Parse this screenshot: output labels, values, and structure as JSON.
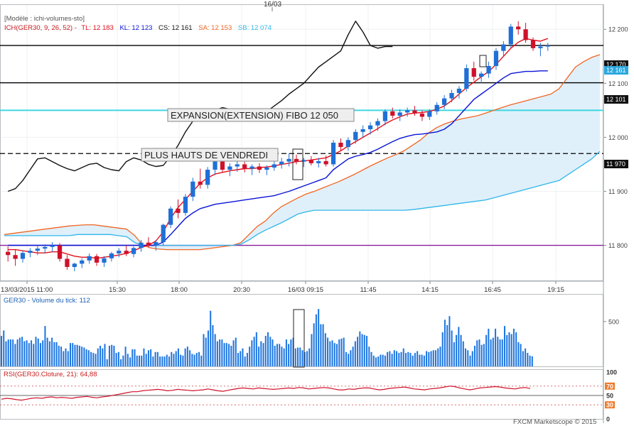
{
  "header": {
    "date_marker": "16/03",
    "model_label": "[Modèle : ichi-volumes-sto]",
    "ichimoku": {
      "name": "ICH(GER30, 9, 26, 52) -",
      "tl_label": "TL: 12 183",
      "kl_label": "KL: 12 123",
      "cs_label": "CS: 12 161",
      "sa_label": "SA: 12 153",
      "sb_label": "SB: 12 074"
    }
  },
  "colors": {
    "candle_up": "#1f6fd6",
    "candle_down": "#d0112b",
    "tenkan": "#e3101a",
    "kijun": "#0a14d6",
    "chikou": "#111111",
    "senkou_a": "#f26522",
    "senkou_b": "#30b6ea",
    "cloud_fill": "#dff0fa",
    "volume": "#1e76e0",
    "rsi": "#d0112b",
    "highlight": "#fff56a"
  },
  "annotations": {
    "fibo": "EXPANSION(EXTENSION) FIBO 12 050",
    "friday_highs": "PLUS HAUTS DE VENDREDI"
  },
  "price_tags": {
    "tag_12170": "12 170",
    "tag_12161": "12 161",
    "tag_12101": "12 101",
    "tag_11970": "11 970"
  },
  "volume_panel": {
    "label": "GER30 - Volume du tick: 112"
  },
  "rsi_panel": {
    "label": "RSI(GER30.Cloture, 21): 64,88"
  },
  "footer": {
    "credit": "FXCM Marketscope © 2015"
  },
  "chart_data": [
    {
      "type": "candlestick",
      "title": "",
      "x_ticks": [
        "13/03/2015 11:00",
        "15:30",
        "18:00",
        "20:30",
        "16/03 09:15",
        "11:45",
        "14:15",
        "16:45",
        "19:15"
      ],
      "y_ticks": [
        11800,
        11900,
        12000,
        12100,
        12200
      ],
      "ylim": [
        11735,
        12245
      ],
      "horizontal_levels": [
        {
          "value": 12170,
          "style": "solid",
          "color": "#000000"
        },
        {
          "value": 12101,
          "style": "solid",
          "color": "#000000"
        },
        {
          "value": 12050,
          "style": "solid",
          "color": "#3fd6e0"
        },
        {
          "value": 11970,
          "style": "dashed",
          "color": "#000000"
        },
        {
          "value": 11800,
          "style": "solid",
          "color": "#8a1f9a"
        }
      ],
      "candles": [
        [
          11788,
          11798,
          11770,
          11782
        ],
        [
          11782,
          11792,
          11762,
          11775
        ],
        [
          11775,
          11790,
          11768,
          11786
        ],
        [
          11786,
          11795,
          11778,
          11790
        ],
        [
          11790,
          11800,
          11782,
          11794
        ],
        [
          11794,
          11802,
          11785,
          11797
        ],
        [
          11797,
          11806,
          11788,
          11800
        ],
        [
          11800,
          11804,
          11770,
          11775
        ],
        [
          11775,
          11782,
          11755,
          11760
        ],
        [
          11760,
          11768,
          11752,
          11766
        ],
        [
          11766,
          11776,
          11758,
          11772
        ],
        [
          11772,
          11785,
          11766,
          11780
        ],
        [
          11780,
          11784,
          11762,
          11768
        ],
        [
          11768,
          11780,
          11760,
          11776
        ],
        [
          11776,
          11788,
          11770,
          11785
        ],
        [
          11785,
          11795,
          11778,
          11790
        ],
        [
          11790,
          11800,
          11780,
          11784
        ],
        [
          11784,
          11798,
          11778,
          11795
        ],
        [
          11795,
          11810,
          11788,
          11805
        ],
        [
          11805,
          11815,
          11796,
          11800
        ],
        [
          11800,
          11810,
          11790,
          11806
        ],
        [
          11806,
          11840,
          11800,
          11838
        ],
        [
          11838,
          11872,
          11832,
          11868
        ],
        [
          11868,
          11885,
          11850,
          11860
        ],
        [
          11860,
          11895,
          11855,
          11890
        ],
        [
          11890,
          11925,
          11882,
          11918
        ],
        [
          11918,
          11942,
          11905,
          11912
        ],
        [
          11912,
          11945,
          11905,
          11940
        ],
        [
          11940,
          11962,
          11930,
          11955
        ],
        [
          11955,
          11962,
          11935,
          11940
        ],
        [
          11940,
          11952,
          11928,
          11946
        ],
        [
          11946,
          11958,
          11936,
          11950
        ],
        [
          11950,
          11955,
          11935,
          11942
        ],
        [
          11942,
          11950,
          11930,
          11946
        ],
        [
          11946,
          11952,
          11934,
          11940
        ],
        [
          11940,
          11948,
          11930,
          11944
        ],
        [
          11944,
          11955,
          11938,
          11950
        ],
        [
          11950,
          11962,
          11942,
          11955
        ],
        [
          11955,
          11970,
          11946,
          11960
        ],
        [
          11960,
          11968,
          11950,
          11955
        ],
        [
          11955,
          11962,
          11945,
          11958
        ],
        [
          11958,
          11965,
          11948,
          11952
        ],
        [
          11952,
          11962,
          11944,
          11956
        ],
        [
          11956,
          11966,
          11946,
          11950
        ],
        [
          11950,
          11995,
          11946,
          11990
        ],
        [
          11990,
          11998,
          11975,
          11982
        ],
        [
          11982,
          12000,
          11975,
          11995
        ],
        [
          11995,
          12015,
          11988,
          12010
        ],
        [
          12010,
          12022,
          12000,
          12015
        ],
        [
          12015,
          12028,
          12005,
          12022
        ],
        [
          12022,
          12035,
          12012,
          12030
        ],
        [
          12030,
          12052,
          12022,
          12048
        ],
        [
          12048,
          12055,
          12035,
          12040
        ],
        [
          12040,
          12052,
          12030,
          12046
        ],
        [
          12046,
          12055,
          12038,
          12050
        ],
        [
          12050,
          12058,
          12040,
          12044
        ],
        [
          12044,
          12050,
          12030,
          12038
        ],
        [
          12038,
          12052,
          12032,
          12048
        ],
        [
          12048,
          12065,
          12042,
          12060
        ],
        [
          12060,
          12078,
          12052,
          12072
        ],
        [
          12072,
          12088,
          12065,
          12082
        ],
        [
          12082,
          12095,
          12072,
          12090
        ],
        [
          12090,
          12135,
          12085,
          12128
        ],
        [
          12128,
          12140,
          12105,
          12112
        ],
        [
          12112,
          12122,
          12100,
          12118
        ],
        [
          12118,
          12140,
          12110,
          12132
        ],
        [
          12132,
          12165,
          12125,
          12160
        ],
        [
          12160,
          12178,
          12150,
          12172
        ],
        [
          12172,
          12210,
          12166,
          12205
        ],
        [
          12205,
          12215,
          12190,
          12200
        ],
        [
          12200,
          12212,
          12175,
          12180
        ],
        [
          12180,
          12185,
          12160,
          12165
        ],
        [
          12165,
          12175,
          12150,
          12168
        ],
        [
          12168,
          12175,
          12160,
          12170
        ]
      ],
      "tenkan": [
        11792,
        11792,
        11790,
        11788,
        11786,
        11786,
        11788,
        11788,
        11784,
        11780,
        11778,
        11778,
        11776,
        11778,
        11780,
        11782,
        11785,
        11790,
        11796,
        11800,
        11808,
        11825,
        11850,
        11870,
        11885,
        11900,
        11915,
        11925,
        11932,
        11935,
        11938,
        11940,
        11942,
        11942,
        11944,
        11945,
        11947,
        11950,
        11952,
        11955,
        11956,
        11958,
        11960,
        11962,
        11968,
        11975,
        11984,
        11992,
        12000,
        12008,
        12016,
        12025,
        12032,
        12038,
        12043,
        12045,
        12046,
        12048,
        12052,
        12058,
        12068,
        12080,
        12092,
        12102,
        12112,
        12122,
        12135,
        12150,
        12165,
        12176,
        12183,
        12180,
        12178,
        12183
      ],
      "kijun": [
        11800,
        11800,
        11800,
        11800,
        11800,
        11800,
        11800,
        11800,
        11800,
        11800,
        11800,
        11800,
        11800,
        11800,
        11800,
        11800,
        11800,
        11800,
        11800,
        11800,
        11800,
        11806,
        11820,
        11835,
        11850,
        11860,
        11868,
        11872,
        11876,
        11878,
        11880,
        11882,
        11884,
        11886,
        11888,
        11890,
        11892,
        11896,
        11900,
        11905,
        11910,
        11915,
        11920,
        11925,
        11940,
        11950,
        11960,
        11965,
        11968,
        11972,
        11978,
        11985,
        11992,
        11998,
        12002,
        12005,
        12006,
        12008,
        12010,
        12015,
        12025,
        12040,
        12055,
        12070,
        12080,
        12090,
        12100,
        12110,
        12118,
        12120,
        12122,
        12122,
        12123,
        12123
      ],
      "senkou_a": [
        11820,
        11822,
        11824,
        11826,
        11828,
        11830,
        11832,
        11834,
        11836,
        11837,
        11838,
        11838,
        11836,
        11834,
        11832,
        11830,
        11818,
        11800,
        11795,
        11793,
        11792,
        11792,
        11792,
        11792,
        11792,
        11794,
        11796,
        11798,
        11800,
        11805,
        11820,
        11835,
        11845,
        11860,
        11872,
        11880,
        11888,
        11895,
        11900,
        11906,
        11912,
        11918,
        11925,
        11932,
        11940,
        11948,
        11955,
        11962,
        11968,
        11975,
        11985,
        11995,
        12008,
        12018,
        12025,
        12030,
        12034,
        12037,
        12040,
        12045,
        12050,
        12055,
        12060,
        12064,
        12068,
        12072,
        12076,
        12080,
        12090,
        12110,
        12130,
        12140,
        12148,
        12153
      ],
      "senkou_b": [
        11818,
        11818,
        11818,
        11818,
        11818,
        11818,
        11818,
        11818,
        11818,
        11820,
        11820,
        11820,
        11820,
        11820,
        11818,
        11816,
        11805,
        11800,
        11800,
        11800,
        11800,
        11800,
        11800,
        11800,
        11800,
        11800,
        11800,
        11800,
        11800,
        11802,
        11810,
        11820,
        11828,
        11835,
        11842,
        11850,
        11858,
        11862,
        11865,
        11865,
        11865,
        11865,
        11865,
        11865,
        11865,
        11865,
        11865,
        11865,
        11865,
        11865,
        11866,
        11868,
        11870,
        11872,
        11874,
        11876,
        11878,
        11880,
        11882,
        11884,
        11888,
        11892,
        11896,
        11900,
        11904,
        11908,
        11912,
        11916,
        11920,
        11930,
        11940,
        11950,
        11960,
        11974
      ],
      "chikou": [
        11900,
        11905,
        11920,
        11940,
        11960,
        11962,
        11955,
        11948,
        11942,
        11938,
        11944,
        11950,
        11952,
        11944,
        11940,
        11938,
        11955,
        11962,
        11958,
        11950,
        11946,
        11948,
        11965,
        11985,
        12010,
        12030,
        12040,
        12045,
        12050,
        12055,
        12052,
        12048,
        12045,
        12040,
        12044,
        12048,
        12058,
        12068,
        12080,
        12090,
        12100,
        12115,
        12130,
        12140,
        12150,
        12160,
        12190,
        12215,
        12195,
        12170,
        12165,
        12168,
        12168
      ]
    },
    {
      "type": "bar",
      "title": "GER30 - Volume du tick: 112",
      "ylim": [
        0,
        760
      ],
      "y_ticks": [
        500
      ],
      "values": [
        340,
        400,
        280,
        300,
        300,
        300,
        250,
        300,
        320,
        330,
        280,
        290,
        260,
        290,
        250,
        330,
        310,
        260,
        290,
        450,
        320,
        280,
        320,
        270,
        270,
        230,
        220,
        170,
        200,
        170,
        260,
        260,
        240,
        240,
        230,
        220,
        210,
        190,
        180,
        160,
        150,
        140,
        200,
        230,
        200,
        250,
        80,
        230,
        240,
        230,
        150,
        160,
        80,
        120,
        220,
        140,
        100,
        190,
        190,
        120,
        120,
        120,
        200,
        140,
        180,
        190,
        110,
        160,
        160,
        110,
        110,
        110,
        130,
        110,
        160,
        140,
        170,
        200,
        130,
        120,
        200,
        220,
        180,
        140,
        130,
        150,
        160,
        120,
        360,
        320,
        400,
        620,
        460,
        360,
        280,
        300,
        300,
        260,
        260,
        250,
        230,
        290,
        320,
        150,
        170,
        200,
        110,
        150,
        220,
        290,
        330,
        380,
        220,
        280,
        260,
        340,
        380,
        330,
        300,
        230,
        250,
        250,
        220,
        200,
        300,
        250,
        300,
        320,
        200,
        210,
        210,
        180,
        160,
        170,
        200,
        360,
        480,
        580,
        640,
        470,
        470,
        370,
        320,
        280,
        290,
        260,
        250,
        300,
        310,
        320,
        160,
        140,
        180,
        220,
        280,
        330,
        390,
        360,
        350,
        340,
        220,
        160,
        120,
        100,
        110,
        130,
        130,
        120,
        160,
        170,
        140,
        180,
        170,
        150,
        160,
        200,
        150,
        160,
        150,
        120,
        150,
        170,
        130,
        130,
        120,
        170,
        160,
        170,
        180,
        180,
        200,
        220,
        380,
        520,
        460,
        560,
        400,
        270,
        350,
        440,
        350,
        280,
        200,
        180,
        120,
        170,
        230,
        290,
        300,
        240,
        250,
        350,
        420,
        300,
        320,
        420,
        330,
        300,
        300,
        450,
        350,
        380,
        360,
        420,
        380,
        270,
        250,
        170,
        200,
        150,
        120,
        112
      ]
    },
    {
      "type": "line",
      "title": "RSI(GER30.Cloture, 21): 64,88",
      "ylim": [
        0,
        100
      ],
      "y_ticks": [
        100,
        70,
        50,
        30,
        0
      ],
      "values": [
        42,
        44,
        43,
        41,
        40,
        42,
        44,
        45,
        44,
        46,
        47,
        45,
        46,
        45,
        44,
        46,
        47,
        48,
        46,
        45,
        47,
        48,
        50,
        52,
        54,
        56,
        58,
        58,
        60,
        61,
        62,
        63,
        62,
        60,
        61,
        63,
        62,
        61,
        60,
        61,
        62,
        64,
        62,
        60,
        59,
        61,
        63,
        65,
        66,
        65,
        64,
        66,
        65,
        64,
        63,
        64,
        65,
        66,
        65,
        67,
        66,
        64,
        65,
        66,
        67,
        66,
        64,
        62,
        62,
        64,
        63,
        65,
        66,
        66,
        64,
        62,
        63,
        65,
        66,
        67,
        68,
        66,
        64,
        63,
        62,
        64,
        65,
        66,
        68,
        70,
        69,
        66,
        64,
        62,
        64,
        66,
        67,
        68,
        69,
        68,
        66,
        65,
        64,
        66,
        67,
        64.88
      ]
    }
  ]
}
